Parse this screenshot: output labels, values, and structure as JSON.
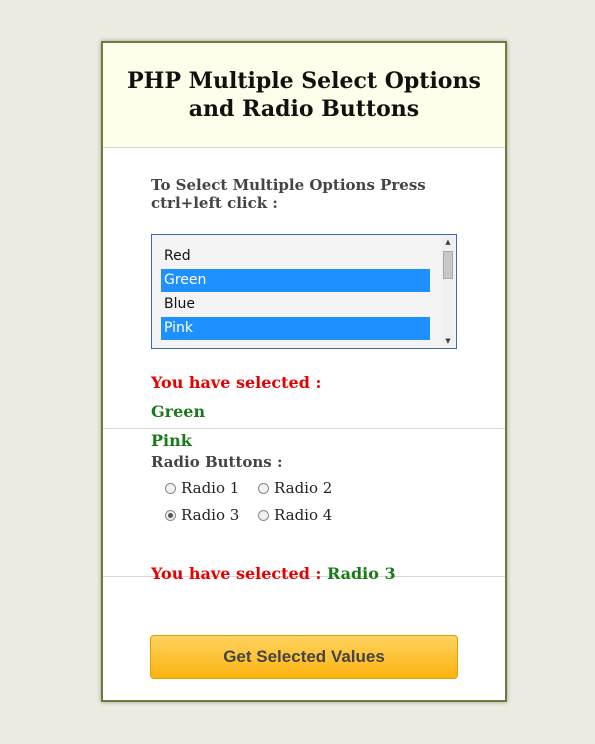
{
  "header": {
    "title": "PHP Multiple Select Options and Radio Buttons"
  },
  "multi_select": {
    "instruction": "To Select Multiple Options Press ctrl+left click :",
    "options": [
      {
        "label": "Red",
        "selected": false
      },
      {
        "label": "Green",
        "selected": true
      },
      {
        "label": "Blue",
        "selected": false
      },
      {
        "label": "Pink",
        "selected": true
      }
    ],
    "result_label": "You have selected :",
    "selected_values": [
      "Green",
      "Pink"
    ]
  },
  "radio_group": {
    "title": "Radio Buttons :",
    "options": [
      {
        "label": "Radio 1",
        "checked": false
      },
      {
        "label": "Radio 2",
        "checked": false
      },
      {
        "label": "Radio 3",
        "checked": true
      },
      {
        "label": "Radio 4",
        "checked": false
      }
    ],
    "result_label": "You have selected :",
    "selected_value": "Radio 3"
  },
  "button": {
    "label": "Get Selected Values"
  },
  "colors": {
    "accent_red": "#e60000",
    "accent_green": "#1a7a1a",
    "selection_blue": "#1e90ff",
    "button_gold": "#fbb310"
  },
  "icons": {
    "scroll_up": "scroll-up-arrow-icon",
    "scroll_down": "scroll-down-arrow-icon"
  }
}
